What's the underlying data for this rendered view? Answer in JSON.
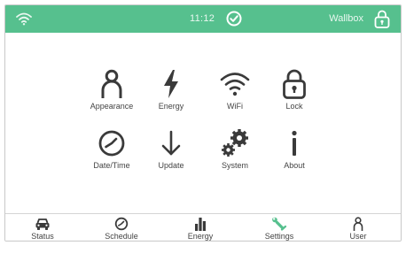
{
  "topbar": {
    "time": "11:12",
    "brand": "Wallbox",
    "background_color": "#56c08e",
    "icons": [
      "wifi-icon",
      "check-circle-icon",
      "lock-icon"
    ]
  },
  "menu": {
    "items": [
      {
        "label": "Appearance",
        "icon": "person-icon"
      },
      {
        "label": "Energy",
        "icon": "lightning-bolt-icon"
      },
      {
        "label": "WiFi",
        "icon": "wifi-icon"
      },
      {
        "label": "Lock",
        "icon": "lock-icon"
      },
      {
        "label": "Date/Time",
        "icon": "clock-icon"
      },
      {
        "label": "Update",
        "icon": "arrow-down-icon"
      },
      {
        "label": "System",
        "icon": "gears-icon"
      },
      {
        "label": "About",
        "icon": "info-icon"
      }
    ],
    "icon_color": "#3a3a3a"
  },
  "bottom_nav": {
    "items": [
      {
        "label": "Status",
        "icon": "car-icon"
      },
      {
        "label": "Schedule",
        "icon": "clock-icon"
      },
      {
        "label": "Energy",
        "icon": "bar-chart-icon"
      },
      {
        "label": "Settings",
        "icon": "wrench-icon",
        "active": true
      },
      {
        "label": "User",
        "icon": "person-icon"
      }
    ],
    "active_color": "#56c08e"
  }
}
